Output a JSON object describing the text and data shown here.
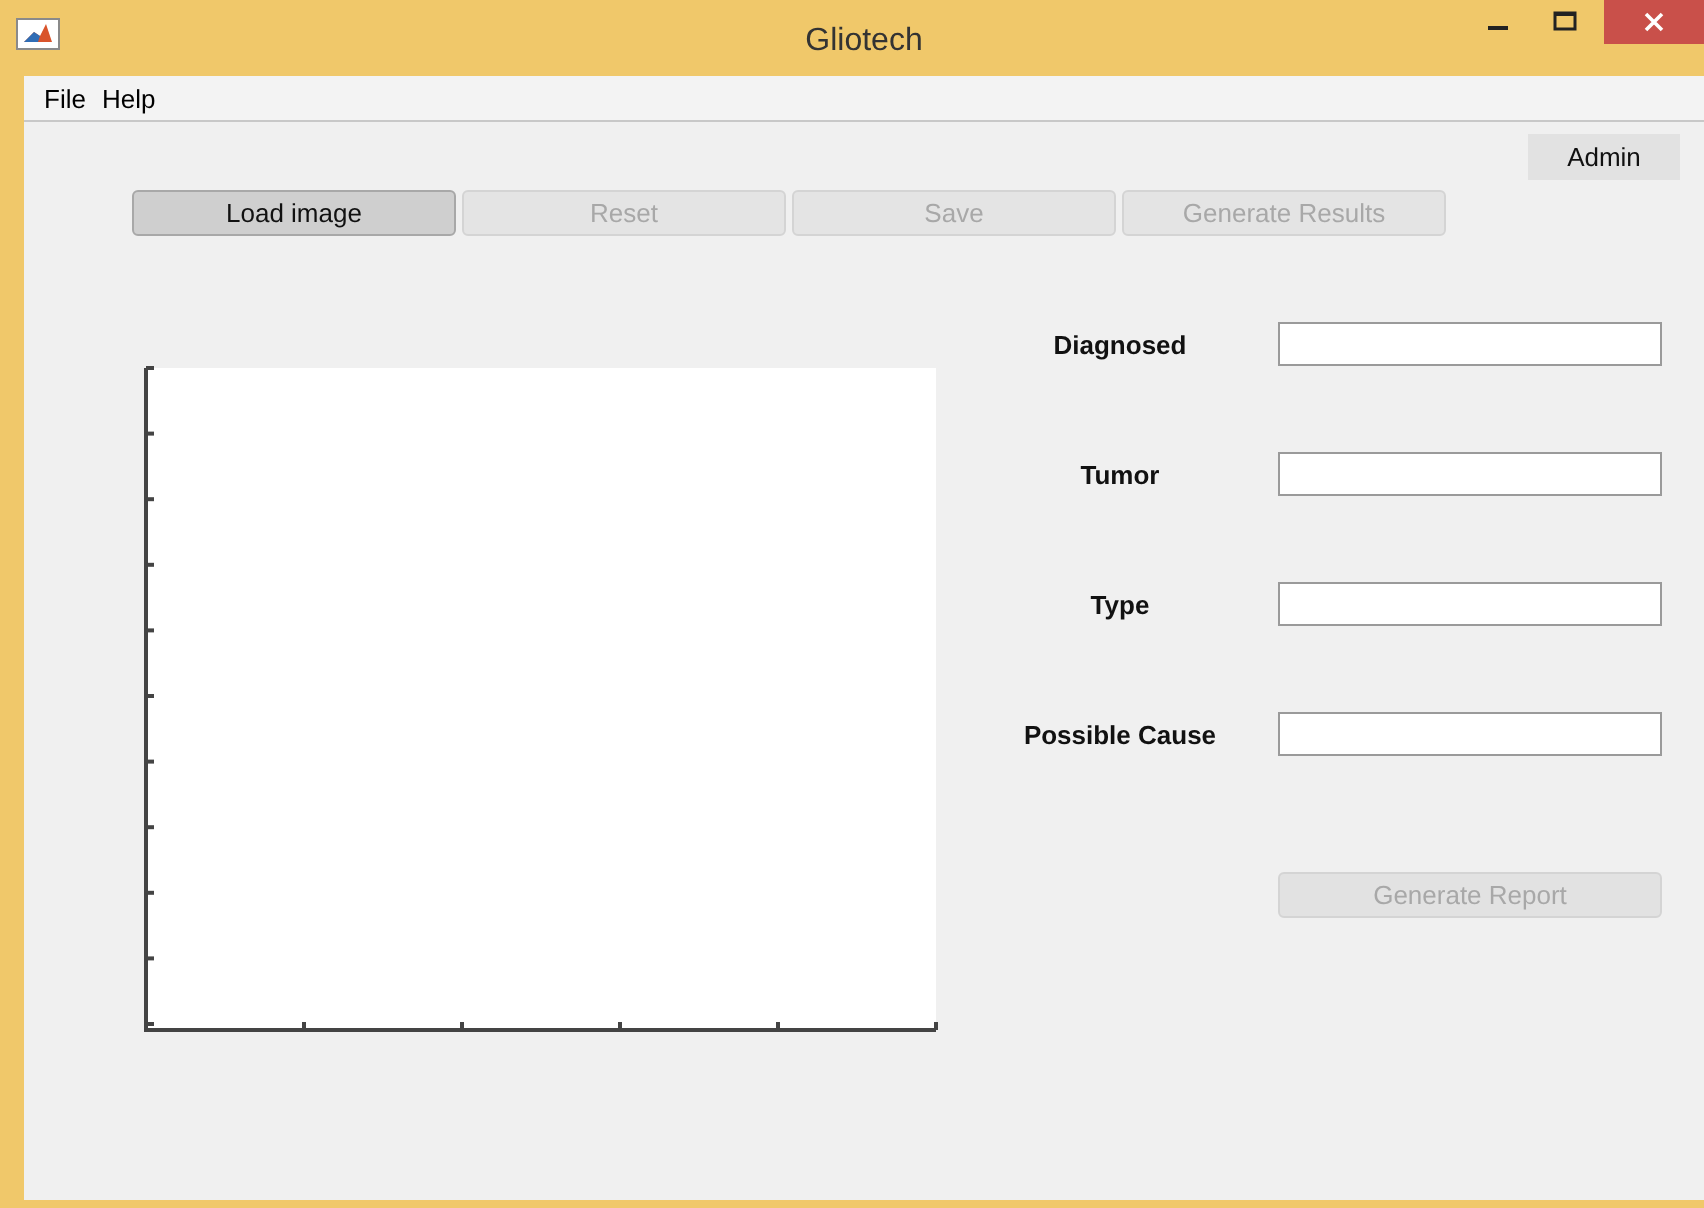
{
  "window": {
    "title": "Gliotech"
  },
  "menu": [
    "File",
    "Help"
  ],
  "admin_button": {
    "label": "Admin"
  },
  "toolbar": [
    {
      "label": "Load image",
      "disabled": false
    },
    {
      "label": "Reset",
      "disabled": true
    },
    {
      "label": "Save",
      "disabled": true
    },
    {
      "label": "Generate Results",
      "disabled": true
    }
  ],
  "fields": [
    {
      "label": "Diagnosed"
    },
    {
      "label": "Tumor"
    },
    {
      "label": "Type"
    },
    {
      "label": "Possible Cause"
    }
  ],
  "report_button": {
    "label": "Generate Report",
    "disabled": true
  }
}
